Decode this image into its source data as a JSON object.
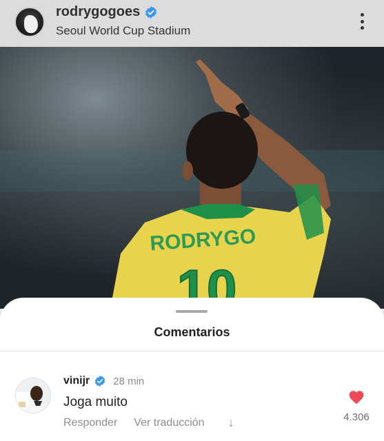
{
  "post": {
    "username": "rodrygogoes",
    "location": "Seoul World Cup Stadium",
    "image": {
      "jersey_name": "RODRYGO",
      "jersey_number": "10"
    }
  },
  "comments_sheet": {
    "title": "Comentarios",
    "comment": {
      "username": "vinijr",
      "time": "28 min",
      "text": "Joga muito",
      "reply_label": "Responder",
      "translate_label": "Ver traducción",
      "like_count": "4.306"
    }
  },
  "colors": {
    "verified_blue": "#3897f0",
    "like_red": "#ed4956",
    "jersey_yellow": "#e7d44c",
    "jersey_green": "#1f8f4a"
  }
}
